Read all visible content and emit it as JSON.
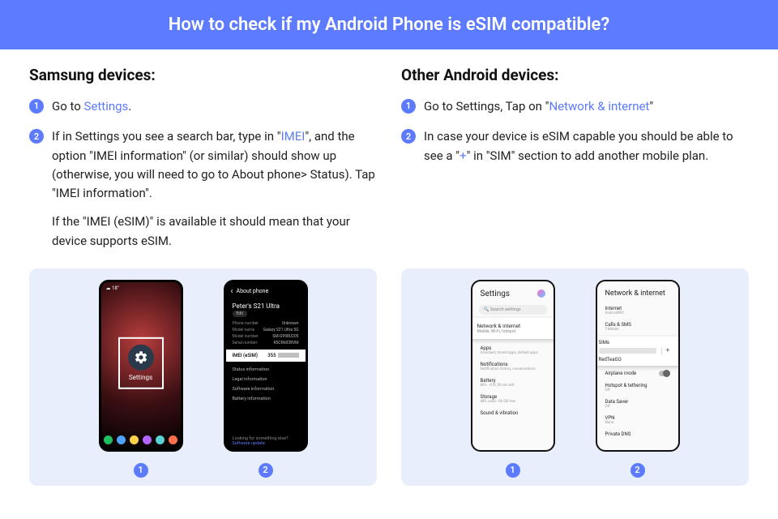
{
  "header": {
    "title": "How to check if my Android Phone is eSIM compatible?"
  },
  "samsung": {
    "heading": "Samsung devices:",
    "step1_a": "Go to ",
    "step1_link": "Settings",
    "step1_b": ".",
    "step2_a": "If in Settings you see a search bar, type in \"",
    "step2_link": "IMEI",
    "step2_b": "\", and the option \"IMEI information\" (or similar) should show up (otherwise, you will need to go to About phone> Status). Tap \"IMEI information\".",
    "step2_sub": "If the \"IMEI (eSIM)\" is available it should mean that your device supports eSIM."
  },
  "other": {
    "heading": "Other Android devices:",
    "step1_a": "Go to Settings, Tap on \"",
    "step1_link": "Network & internet",
    "step1_b": "\"",
    "step2_a": "In case your device is eSIM capable you should be able to see a \"",
    "step2_link": "+",
    "step2_b": "\" in \"SIM\" section to add another mobile plan."
  },
  "shots": {
    "s1": {
      "weather": "18°",
      "settings": "Settings",
      "num": "1"
    },
    "s2": {
      "title": "About phone",
      "device": "Peter's S21 Ultra",
      "edit": "Edit",
      "rows": {
        "phone_k": "Phone number",
        "phone_v": "Unknown",
        "model_k": "Model name",
        "model_v": "Galaxy S21 Ultra 5G",
        "modelno_k": "Model number",
        "modelno_v": "SM-G998U205",
        "serial_k": "Serial number",
        "serial_v": "R5CR6038VM"
      },
      "hl_label": "IMEI (eSIM)",
      "hl_value": "355",
      "sec1": "Status information",
      "sec2": "Legal information",
      "sec3": "Software information",
      "sec4": "Battery information",
      "foot_q": "Looking for something else?",
      "foot_a": "Software update",
      "num": "2"
    },
    "o1": {
      "title": "Settings",
      "search": "Search settings",
      "card_title": "Network & internet",
      "card_sub": "Mobile, Wi-Fi, hotspot",
      "items": {
        "apps": "Apps",
        "apps_sub": "Assistant, recent apps, default apps",
        "notif": "Notifications",
        "notif_sub": "Notification history, conversations",
        "batt": "Battery",
        "batt_sub": "86% - 6 hr 20 min left",
        "stor": "Storage",
        "stor_sub": "48% used - 66 GB free",
        "sound": "Sound & vibration"
      },
      "num": "1"
    },
    "o2": {
      "title": "Network & internet",
      "items": {
        "inet": "Internet",
        "inet_sub": "AndroidWifi",
        "calls": "Calls & SMS",
        "calls_sub": "T-Mobile",
        "sims": "SIMs",
        "sims_sub": "RedTeaGO",
        "plus": "+",
        "air": "Airplane mode",
        "hot": "Hotspot & tethering",
        "hot_sub": "Off",
        "ds": "Data Saver",
        "ds_sub": "Off",
        "vpn": "VPN",
        "vpn_sub": "None",
        "dns": "Private DNS"
      },
      "num": "2"
    }
  }
}
